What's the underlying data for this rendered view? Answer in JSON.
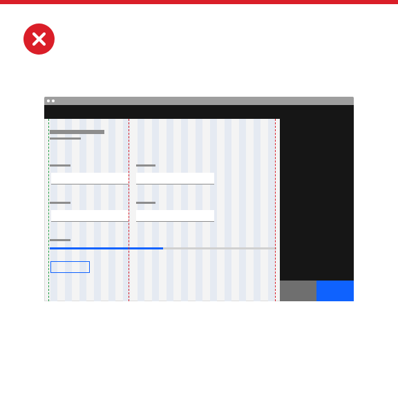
{
  "colors": {
    "error_red": "#da1e28",
    "accent_blue": "#0f62fe",
    "guide_green": "#24a148",
    "guide_red": "#da1e28"
  },
  "icons": {
    "status": "close-icon"
  },
  "progress": {
    "fraction": 0.5
  }
}
